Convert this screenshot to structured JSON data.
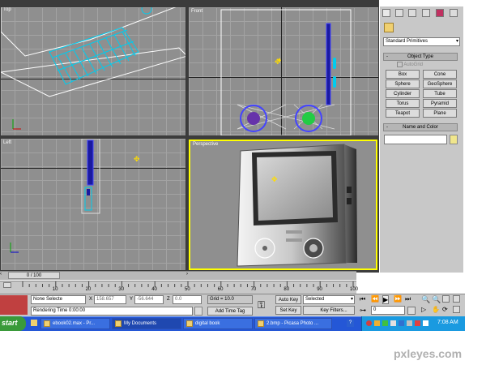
{
  "viewports": {
    "top": {
      "label": "Top"
    },
    "front": {
      "label": "Front"
    },
    "left": {
      "label": "Left"
    },
    "perspective": {
      "label": "Perspective"
    }
  },
  "command_panel": {
    "tab_icons": [
      "create-icon",
      "modify-icon",
      "hierarchy-icon",
      "motion-icon",
      "display-icon",
      "utilities-icon"
    ],
    "category_dropdown": "Standard Primitives",
    "object_type_header": "Object Type",
    "autogrid_label": "AutoGrid",
    "object_buttons": [
      "Box",
      "Cone",
      "Sphere",
      "GeoSphere",
      "Cylinder",
      "Tube",
      "Torus",
      "Pyramid",
      "Teapot",
      "Plane"
    ],
    "name_color_header": "Name and Color",
    "name_value": "",
    "color_swatch": "#f0e68c"
  },
  "timeline": {
    "slider_label": "0 / 100",
    "ticks": [
      "10",
      "20",
      "30",
      "40",
      "50",
      "60",
      "70",
      "80",
      "90",
      "100"
    ]
  },
  "status_bar": {
    "selection": "None Selecte",
    "x_label": "X",
    "x_value": "158.657",
    "y_label": "Y",
    "y_value": "-56.644",
    "z_label": "Z",
    "z_value": "0.0",
    "grid": "Grid = 10.0",
    "auto_key": "Auto Key",
    "set_key": "Set Key",
    "selected_dropdown": "Selected",
    "key_filters": "Key Filters...",
    "frame_value": "0",
    "rendering_time": "Rendering Time  0:00:00",
    "add_time_tag": "Add Time Tag"
  },
  "taskbar": {
    "start": "start",
    "items": [
      {
        "label": "ebook02.max - Pr...",
        "active": false
      },
      {
        "label": "My Documents",
        "active": true
      },
      {
        "label": "digital book",
        "active": false
      },
      {
        "label": "2.bmp - Picasa Photo ...",
        "active": false
      }
    ],
    "clock": "7:08 AM"
  },
  "watermark": "pxleyes.com",
  "colors": {
    "viewport_bg": "#8f8f8f",
    "active_border": "#ffff00",
    "wire_cyan": "#00ccee",
    "taskbar_blue": "#2457d6",
    "start_green": "#3a9a3a"
  }
}
